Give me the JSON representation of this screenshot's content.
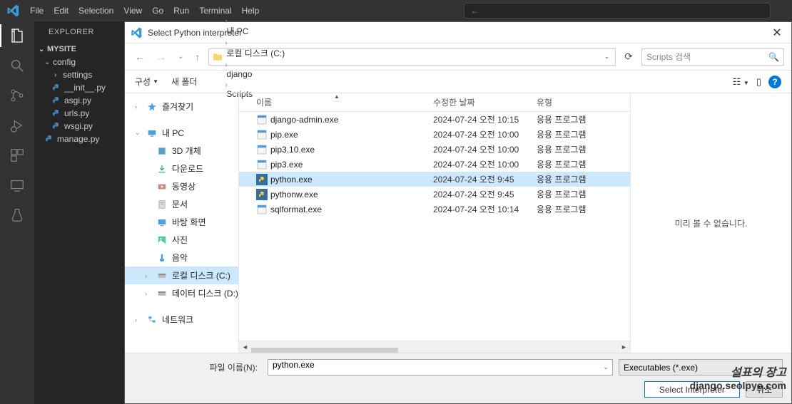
{
  "menu": {
    "items": [
      "File",
      "Edit",
      "Selection",
      "View",
      "Go",
      "Run",
      "Terminal",
      "Help"
    ],
    "search_arrow": "←"
  },
  "explorer": {
    "title": "EXPLORER",
    "root": "MYSITE",
    "folder": "config",
    "subfolder": "settings",
    "files": [
      "__init__.py",
      "asgi.py",
      "urls.py",
      "wsgi.py"
    ],
    "root_file": "manage.py"
  },
  "dialog": {
    "title": "Select Python interpreter",
    "breadcrumb": [
      "내 PC",
      "로컬 디스크 (C:)",
      "django",
      "Scripts"
    ],
    "search_placeholder": "Scripts 검색",
    "toolbar": {
      "organize": "구성",
      "newfolder": "새 폴더"
    },
    "nav": {
      "quick": "즐겨찾기",
      "pc": "내 PC",
      "children": [
        "3D 개체",
        "다운로드",
        "동영상",
        "문서",
        "바탕 화면",
        "사진",
        "음악",
        "로컬 디스크 (C:)",
        "데이터 디스크 (D:)"
      ],
      "selected_index": 7,
      "network": "네트워크"
    },
    "cols": {
      "name": "이름",
      "date": "수정한 날짜",
      "type": "유형"
    },
    "rows": [
      {
        "name": "django-admin.exe",
        "date": "2024-07-24 오전 10:15",
        "type": "응용 프로그램",
        "icon": "app",
        "sel": false
      },
      {
        "name": "pip.exe",
        "date": "2024-07-24 오전 10:00",
        "type": "응용 프로그램",
        "icon": "app",
        "sel": false
      },
      {
        "name": "pip3.10.exe",
        "date": "2024-07-24 오전 10:00",
        "type": "응용 프로그램",
        "icon": "app",
        "sel": false
      },
      {
        "name": "pip3.exe",
        "date": "2024-07-24 오전 10:00",
        "type": "응용 프로그램",
        "icon": "app",
        "sel": false
      },
      {
        "name": "python.exe",
        "date": "2024-07-24 오전 9:45",
        "type": "응용 프로그램",
        "icon": "py",
        "sel": true
      },
      {
        "name": "pythonw.exe",
        "date": "2024-07-24 오전 9:45",
        "type": "응용 프로그램",
        "icon": "py",
        "sel": false
      },
      {
        "name": "sqlformat.exe",
        "date": "2024-07-24 오전 10:14",
        "type": "응용 프로그램",
        "icon": "app",
        "sel": false
      }
    ],
    "preview": "미리 볼 수 없습니다.",
    "footer": {
      "filename_label": "파일 이름(N):",
      "filename_value": "python.exe",
      "filter": "Executables (*.exe)",
      "ok": "Select Interpreter",
      "cancel": "취소"
    }
  },
  "watermark": {
    "line1": "설표의 장고",
    "line2": "django.seolpyo.com"
  }
}
